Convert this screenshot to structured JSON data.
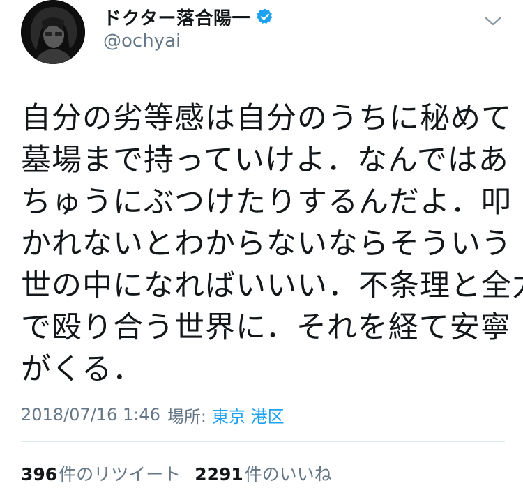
{
  "author": {
    "display_name": "ドクター落合陽一",
    "handle": "@ochyai",
    "verified": true,
    "avatar_icon": "profile-photo",
    "verified_icon": "verified-badge-icon"
  },
  "tweet": {
    "lines": [
      "自分の劣等感は自分のうちに秘めて",
      "墓場まで持っていけよ．なんではあ",
      "ちゅうにぶつけたりするんだよ．叩",
      "かれないとわからないならそういう",
      "世の中になればいいい．不条理と全力",
      "で殴り合う世界に．それを経て安寧",
      "がくる．"
    ]
  },
  "meta": {
    "timestamp": "2018/07/16 1:46",
    "location_label": "場所:",
    "location": "東京 港区"
  },
  "stats": {
    "retweets_count": "396",
    "retweets_label": "件のリツイート",
    "likes_count": "2291",
    "likes_label": "件のいいね"
  },
  "colors": {
    "text": "#14171a",
    "secondary": "#657786",
    "accent": "#1da1f2",
    "divider": "#e1e8ed"
  }
}
